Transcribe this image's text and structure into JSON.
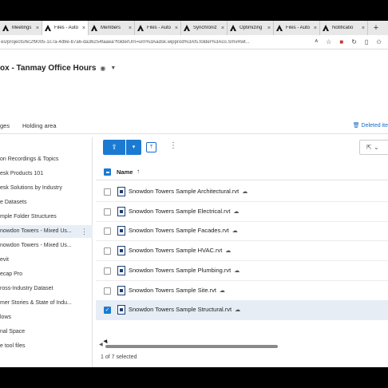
{
  "browser": {
    "tabs": [
      {
        "label": "Meetings",
        "active": false
      },
      {
        "label": "Files - Auto",
        "active": true
      },
      {
        "label": "Members",
        "active": false
      },
      {
        "label": "Files - Auto",
        "active": false
      },
      {
        "label": "Synchroniz",
        "active": false
      },
      {
        "label": "Optimizing",
        "active": false
      },
      {
        "label": "Files - Auto",
        "active": false
      },
      {
        "label": "Notificatio",
        "active": false
      }
    ],
    "new_tab": "+",
    "url": "es/projects/6c2f9005-1c7a-4d9e-b7a6-da36254faaea?folderUrn=urn%3Aadsk.wipprod%3Afs.folder%3Aco.SmvRwt..."
  },
  "project": {
    "title": "ox - Tanmay Office Hours",
    "globe_icon": "globe-icon",
    "caret_icon": "chevron-down-icon"
  },
  "nav": {
    "tab1": "ges",
    "tab2": "Holding area",
    "deleted": "Deleted ite"
  },
  "folders": [
    {
      "label": "Recordings & Topics",
      "prefix": "on "
    },
    {
      "label": "esk Products 101"
    },
    {
      "label": "esk Solutions by Industry"
    },
    {
      "label": "e Datasets"
    },
    {
      "label": "mple Folder Structures"
    },
    {
      "label": "nowdon Towers - Mixed Us...",
      "selected": true,
      "more": "⋮"
    },
    {
      "label": "nowdon Towers - Mixed Us..."
    },
    {
      "label": "evit"
    },
    {
      "label": "ecap Pro"
    },
    {
      "label": "ross-Industry Dataset"
    },
    {
      "label": "mer Stories & State of Indu..."
    },
    {
      "label": "lows"
    },
    {
      "label": "nal Space"
    },
    {
      "label": "e tool files"
    }
  ],
  "toolbar": {
    "upload_icon": "cloud-upload-icon",
    "upload_caret": "chevron-down-icon",
    "tool_icon": "upload-box-icon",
    "more_icon": "⋮",
    "share_icon": "share-icon"
  },
  "table": {
    "column_name": "Name",
    "sort": "↑",
    "files": [
      {
        "name": "Snowdon Towers Sample Architectural.rvt",
        "checked": false
      },
      {
        "name": "Snowdon Towers Sample Electrical.rvt",
        "checked": false
      },
      {
        "name": "Snowdon Towers Sample Facades.rvt",
        "checked": false
      },
      {
        "name": "Snowdon Towers Sample HVAC.rvt",
        "checked": false
      },
      {
        "name": "Snowdon Towers Sample Plumbing.rvt",
        "checked": false
      },
      {
        "name": "Snowdon Towers Sample Site.rvt",
        "checked": false
      },
      {
        "name": "Snowdon Towers Sample Structural.rvt",
        "checked": true
      }
    ]
  },
  "status": "1 of 7 selected",
  "colors": {
    "accent": "#1b7ad1",
    "selected_row": "#e6edf5"
  }
}
